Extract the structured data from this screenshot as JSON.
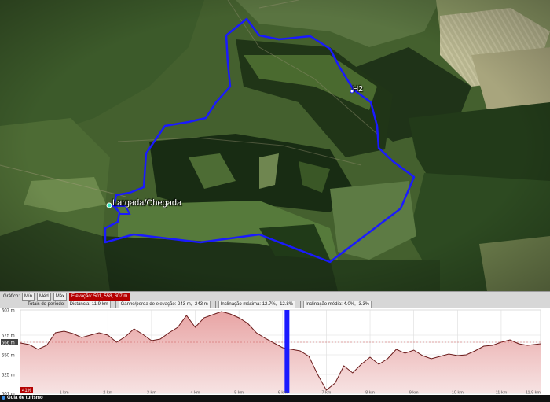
{
  "map": {
    "start_label": "Largada/Chegada",
    "waypoint_label": "H2",
    "colors": {
      "route": "#1a1aff",
      "pin": "#33e6c0"
    }
  },
  "profile_toolbar": {
    "graph_label": "Gráfico:",
    "min_label": "Mín",
    "avg_label": "Méd",
    "max_label": "Máx",
    "elevation_value": "Elevação: 501, 558, 607 m",
    "totals_label": "Totais do período:",
    "distance_value": "Distância: 11.9 km",
    "gain_value": "Ganho/perda de elevação: 243 m, -243 m",
    "max_slope_value": "Inclinação máxima: 12.7%, -12.8%",
    "avg_slope_value": "Inclinação média: 4.0%, -3.3%"
  },
  "chart_data": {
    "type": "area",
    "title": "",
    "xlabel": "",
    "ylabel": "",
    "x_unit": "km",
    "y_unit": "m",
    "xlim": [
      0,
      11.9
    ],
    "ylim": [
      501,
      607
    ],
    "y_ticks": [
      "607 m",
      "575 m",
      "566 m",
      "550 m",
      "525 m",
      "501 m"
    ],
    "y_tick_values": [
      607,
      575,
      566,
      550,
      525,
      501
    ],
    "x_ticks": [
      "1 km",
      "2 km",
      "3 km",
      "4 km",
      "5 km",
      "6 km",
      "7 km",
      "8 km",
      "9 km",
      "10 km",
      "11 km",
      "11.9 km"
    ],
    "x_tick_values": [
      1,
      2,
      3,
      4,
      5,
      6,
      7,
      8,
      9,
      10,
      11,
      11.9
    ],
    "highlight_y": 566,
    "highlight_low": "41%",
    "cursor_km": 6.1,
    "grid": true,
    "colors": {
      "line": "#6b1b1b",
      "fill_top": "#e8a4a4",
      "fill_bottom": "#f7e3e3",
      "cursor": "#1a1aff"
    },
    "series": [
      {
        "x": [
          0,
          0.2,
          0.4,
          0.6,
          0.8,
          1.0,
          1.2,
          1.4,
          1.6,
          1.8,
          2.0,
          2.2,
          2.4,
          2.6,
          2.8,
          3.0,
          3.2,
          3.4,
          3.6,
          3.8,
          4.0,
          4.2,
          4.4,
          4.6,
          4.8,
          5.0,
          5.2,
          5.4,
          5.6,
          5.8,
          6.0,
          6.2,
          6.4,
          6.6,
          6.8,
          7.0,
          7.2,
          7.4,
          7.6,
          7.8,
          8.0,
          8.2,
          8.4,
          8.6,
          8.8,
          9.0,
          9.2,
          9.4,
          9.6,
          9.8,
          10.0,
          10.2,
          10.4,
          10.6,
          10.8,
          11.0,
          11.2,
          11.4,
          11.6,
          11.9
        ],
        "y": [
          565,
          563,
          557,
          562,
          578,
          580,
          577,
          572,
          575,
          578,
          575,
          566,
          573,
          583,
          576,
          568,
          570,
          578,
          585,
          600,
          585,
          597,
          601,
          605,
          602,
          597,
          590,
          578,
          571,
          565,
          559,
          557,
          555,
          548,
          525,
          505,
          514,
          536,
          527,
          538,
          547,
          538,
          545,
          557,
          552,
          556,
          549,
          545,
          548,
          551,
          549,
          550,
          555,
          561,
          562,
          566,
          569,
          564,
          562,
          564
        ]
      }
    ]
  }
}
